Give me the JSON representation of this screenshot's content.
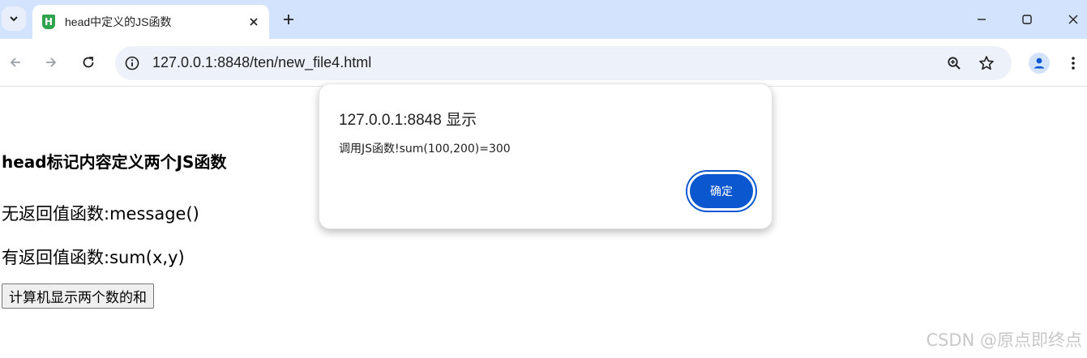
{
  "browser": {
    "tab_title": "head中定义的JS函数",
    "favicon_letter": "H",
    "url": "127.0.0.1:8848/ten/new_file4.html",
    "accent_color": "#0b57d0",
    "icons": {
      "tab_search": "chevron-down-icon",
      "close_tab": "close-icon",
      "new_tab": "plus-icon",
      "minimize": "minimize-icon",
      "maximize": "maximize-icon",
      "close_window": "close-icon",
      "back": "arrow-left-icon",
      "forward": "arrow-right-icon",
      "reload": "reload-icon",
      "site_info": "info-icon",
      "zoom": "zoom-icon",
      "bookmark": "star-icon",
      "profile": "person-icon",
      "menu": "kebab-menu-icon"
    }
  },
  "page": {
    "heading": "head标记内容定义两个JS函数",
    "line1": "无返回值函数:message()",
    "line2": "有返回值函数:sum(x,y)",
    "button_label": "计算机显示两个数的和"
  },
  "dialog": {
    "title": "127.0.0.1:8848 显示",
    "message": "调用JS函数!sum(100,200)=300",
    "ok_label": "确定"
  },
  "watermark": "CSDN @原点即终点"
}
